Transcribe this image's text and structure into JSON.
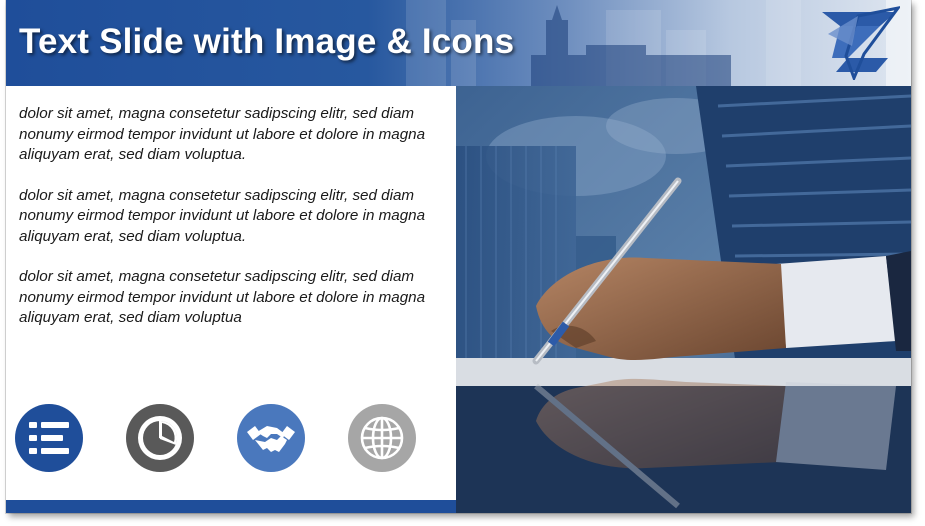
{
  "slide": {
    "title": "Text Slide with Image & Icons",
    "paragraphs": [
      "dolor sit amet, magna consetetur sadipscing elitr, sed diam nonumy eirmod tempor invidunt ut labore et dolore in magna aliquyam erat, sed diam voluptua.",
      "dolor sit amet, magna consetetur sadipscing elitr, sed diam nonumy eirmod tempor invidunt ut labore et dolore in magna aliquyam erat, sed diam voluptua.",
      "dolor sit amet, magna consetetur sadipscing elitr, sed diam nonumy eirmod tempor invidunt ut labore et dolore in magna aliquyam erat, sed diam voluptua"
    ],
    "icons": [
      {
        "name": "list-icon",
        "color": "#1f4e9a"
      },
      {
        "name": "pie-chart-icon",
        "color": "#595959"
      },
      {
        "name": "handshake-icon",
        "color": "#4a78bd"
      },
      {
        "name": "globe-icon",
        "color": "#a6a6a6"
      }
    ],
    "image": {
      "name": "hand-writing-with-pen-photo"
    },
    "colors": {
      "primary": "#1f4e9a",
      "accent": "#4a78bd",
      "dark_gray": "#595959",
      "light_gray": "#a6a6a6"
    }
  }
}
